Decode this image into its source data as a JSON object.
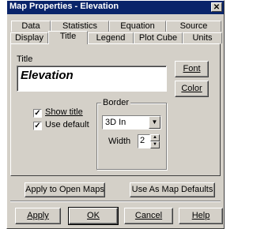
{
  "window": {
    "title": "Map Properties - Elevation",
    "close_glyph": "✕"
  },
  "tabs_back": [
    "Data",
    "Statistics",
    "Equation",
    "Source"
  ],
  "tabs_front": [
    "Display",
    "Title",
    "Legend",
    "Plot Cube",
    "Units"
  ],
  "active_tab": "Title",
  "title_section": {
    "label": "Title",
    "value": "Elevation",
    "font_button": "Font",
    "color_button": "Color"
  },
  "checkboxes": {
    "show_title": {
      "label": "Show title",
      "checked": true
    },
    "use_default": {
      "label": "Use default",
      "checked": true
    }
  },
  "border": {
    "label": "Border",
    "style_value": "3D In",
    "width_label": "Width",
    "width_value": "2"
  },
  "map_buttons": {
    "apply_to_open": "Apply to Open Maps",
    "use_as_defaults": "Use As Map Defaults"
  },
  "dialog_buttons": {
    "apply": "Apply",
    "ok": "OK",
    "cancel": "Cancel",
    "help": "Help"
  },
  "colors": {
    "titlebar": "#0a246a",
    "face": "#d4d0c8"
  }
}
